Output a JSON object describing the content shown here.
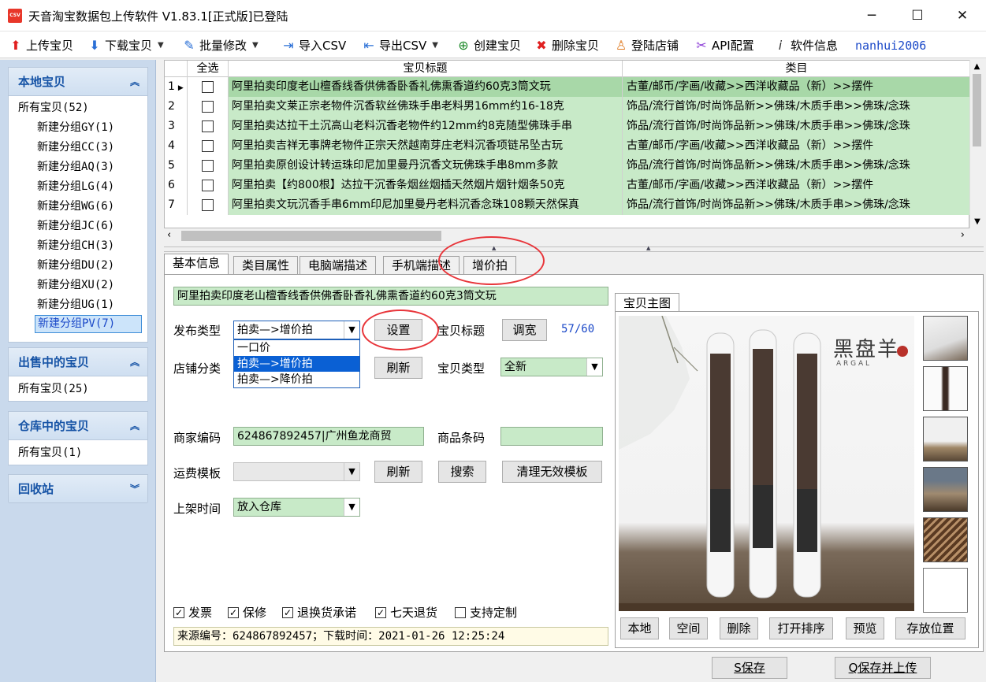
{
  "window": {
    "app_icon_text": "CSV",
    "title": "天音淘宝数据包上传软件 V1.83.1[正式版]已登陆",
    "minimize": "─",
    "maximize": "☐",
    "close": "✕"
  },
  "toolbar": {
    "upload": "上传宝贝",
    "download": "下载宝贝",
    "batch_edit": "批量修改",
    "import_csv": "导入CSV",
    "export_csv": "导出CSV",
    "create": "创建宝贝",
    "delete": "删除宝贝",
    "login_shop": "登陆店铺",
    "api_config": "API配置",
    "software_info": "软件信息",
    "username": "nanhui2006"
  },
  "sidebar": {
    "local": {
      "title": "本地宝贝",
      "all": "所有宝贝(52)",
      "groups": [
        "新建分组GY(1)",
        "新建分组CC(3)",
        "新建分组AQ(3)",
        "新建分组LG(4)",
        "新建分组WG(6)",
        "新建分组JC(6)",
        "新建分组CH(3)",
        "新建分组DU(2)",
        "新建分组XU(2)",
        "新建分组UG(1)",
        "新建分组PV(7)"
      ]
    },
    "selling": {
      "title": "出售中的宝贝",
      "all": "所有宝贝(25)"
    },
    "warehouse": {
      "title": "仓库中的宝贝",
      "all": "所有宝贝(1)"
    },
    "recycle": {
      "title": "回收站"
    }
  },
  "grid": {
    "headers": {
      "select_all": "全选",
      "title": "宝贝标题",
      "category": "类目"
    },
    "rows": [
      {
        "num": "1",
        "title": "阿里拍卖印度老山檀香线香供佛香卧香礼佛熏香道约60克3筒文玩",
        "category": "古董/邮币/字画/收藏>>西洋收藏品（新）>>摆件"
      },
      {
        "num": "2",
        "title": "阿里拍卖文莱正宗老物件沉香软丝佛珠手串老料男16mm约16-18克",
        "category": "饰品/流行首饰/时尚饰品新>>佛珠/木质手串>>佛珠/念珠"
      },
      {
        "num": "3",
        "title": "阿里拍卖达拉干土沉高山老料沉香老物件约12mm约8克随型佛珠手串",
        "category": "饰品/流行首饰/时尚饰品新>>佛珠/木质手串>>佛珠/念珠"
      },
      {
        "num": "4",
        "title": "阿里拍卖吉祥无事牌老物件正宗天然越南芽庄老料沉香项链吊坠古玩",
        "category": "古董/邮币/字画/收藏>>西洋收藏品（新）>>摆件"
      },
      {
        "num": "5",
        "title": "阿里拍卖原创设计转运珠印尼加里曼丹沉香文玩佛珠手串8mm多款",
        "category": "饰品/流行首饰/时尚饰品新>>佛珠/木质手串>>佛珠/念珠"
      },
      {
        "num": "6",
        "title": "阿里拍卖【约800根】达拉干沉香条烟丝烟插天然烟片烟针烟条50克",
        "category": "古董/邮币/字画/收藏>>西洋收藏品（新）>>摆件"
      },
      {
        "num": "7",
        "title": "阿里拍卖文玩沉香手串6mm印尼加里曼丹老料沉香念珠108颗天然保真",
        "category": "饰品/流行首饰/时尚饰品新>>佛珠/木质手串>>佛珠/念珠"
      }
    ]
  },
  "tabs": [
    "基本信息",
    "类目属性",
    "电脑端描述",
    "手机端描述",
    "增价拍"
  ],
  "form": {
    "title_value": "阿里拍卖印度老山檀香线香供佛香卧香礼佛熏香道约60克3筒文玩",
    "publish_type_label": "发布类型",
    "publish_type_value": "拍卖—>增价拍",
    "publish_type_options": [
      "一口价",
      "拍卖—>增价拍",
      "拍卖—>降价拍"
    ],
    "settings_button": "设置",
    "item_title_label": "宝贝标题",
    "adjust_width_button": "调宽",
    "title_count": "57/60",
    "shop_category_label": "店铺分类",
    "refresh_button": "刷新",
    "item_type_label": "宝贝类型",
    "item_type_value": "全新",
    "merchant_code_label": "商家编码",
    "merchant_code_value": "624867892457|广州鱼龙商贸",
    "barcode_label": "商品条码",
    "barcode_value": "",
    "shipping_label": "运费模板",
    "shipping_value": "",
    "refresh2_button": "刷新",
    "search_button": "搜索",
    "clean_templates_button": "清理无效模板",
    "listing_time_label": "上架时间",
    "listing_time_value": "放入仓库",
    "checkboxes": [
      {
        "label": "发票",
        "checked": true
      },
      {
        "label": "保修",
        "checked": true
      },
      {
        "label": "退换货承诺",
        "checked": true
      },
      {
        "label": "七天退货",
        "checked": true
      },
      {
        "label": "支持定制",
        "checked": false
      }
    ],
    "source_info": "来源编号：624867892457；下载时间：2021-01-26 12:25:24"
  },
  "image_panel": {
    "title": "宝贝主图",
    "brand_text": "黑盘羊",
    "brand_sub": "A R G A L",
    "buttons": [
      "本地",
      "空间",
      "删除",
      "打开排序",
      "预览",
      "存放位置"
    ]
  },
  "footer": {
    "save": "S保存",
    "save_upload": "Q保存并上传"
  }
}
